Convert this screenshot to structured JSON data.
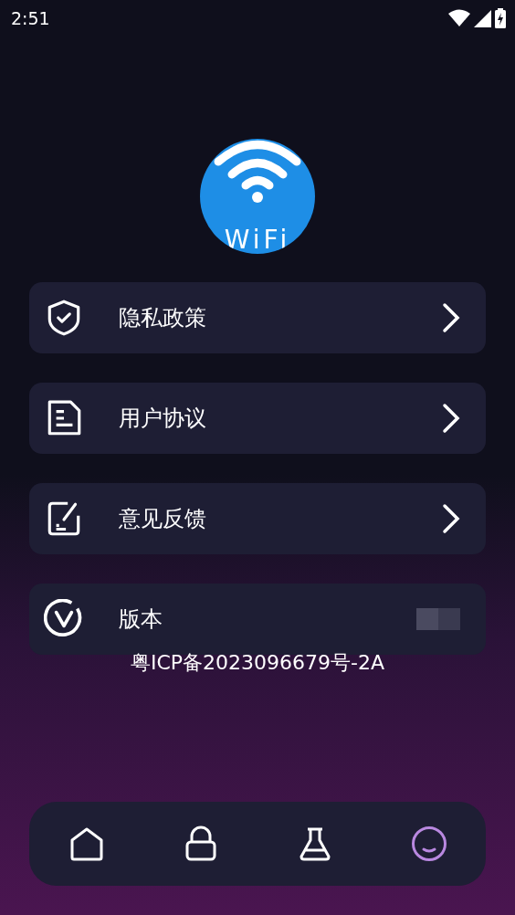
{
  "status_bar": {
    "time": "2:51"
  },
  "logo": {
    "text": "WiFi"
  },
  "menu": [
    {
      "label": "隐私政策",
      "arrow": true
    },
    {
      "label": "用户协议",
      "arrow": true
    },
    {
      "label": "意见反馈",
      "arrow": true
    },
    {
      "label": "版本",
      "arrow": false
    }
  ],
  "icp": "粤ICP备2023096679号-2A",
  "nav": [
    {
      "selected": false
    },
    {
      "selected": false
    },
    {
      "selected": false
    },
    {
      "selected": true
    }
  ]
}
